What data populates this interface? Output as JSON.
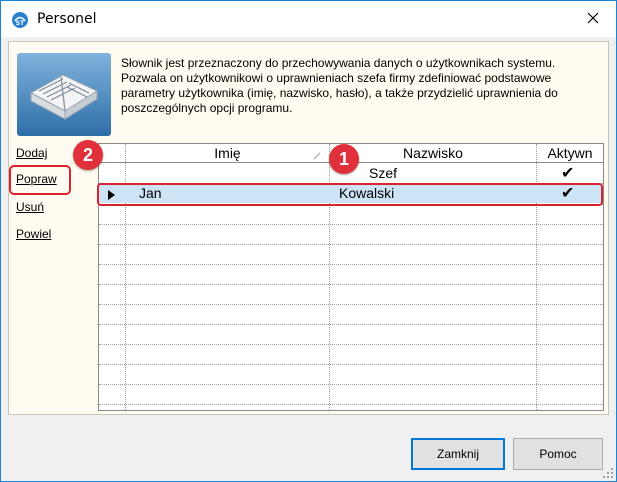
{
  "window": {
    "title": "Personel",
    "close_icon": "close-icon",
    "app_icon": "app-logo-icon"
  },
  "description": "Słownik jest przeznaczony do przechowywania danych o użytkownikach systemu. Pozwala on użytkownikowi o uprawnieniach szefa firmy zdefiniować podstawowe parametry użytkownika (imię, nazwisko, hasło), a także przydzielić uprawnienia do poszczególnych opcji programu.",
  "actions": [
    {
      "label": "Dodaj"
    },
    {
      "label": "Popraw"
    },
    {
      "label": "Usuń"
    },
    {
      "label": "Powiel"
    }
  ],
  "grid": {
    "columns": [
      "Imię",
      "Nazwisko",
      "Aktywn"
    ],
    "rows": [
      {
        "imie": "",
        "nazwisko": "Szef",
        "aktywny": "✔",
        "selected": false
      },
      {
        "imie": "Jan",
        "nazwisko": "Kowalski",
        "aktywny": "✔",
        "selected": true
      }
    ]
  },
  "badges": [
    {
      "number": "1"
    },
    {
      "number": "2"
    }
  ],
  "buttons": {
    "close": "Zamknij",
    "help": "Pomoc"
  },
  "colors": {
    "badge": "#e0303c",
    "highlight": "#d9232e",
    "selection": "#cde3f6",
    "accent": "#0078d7"
  }
}
